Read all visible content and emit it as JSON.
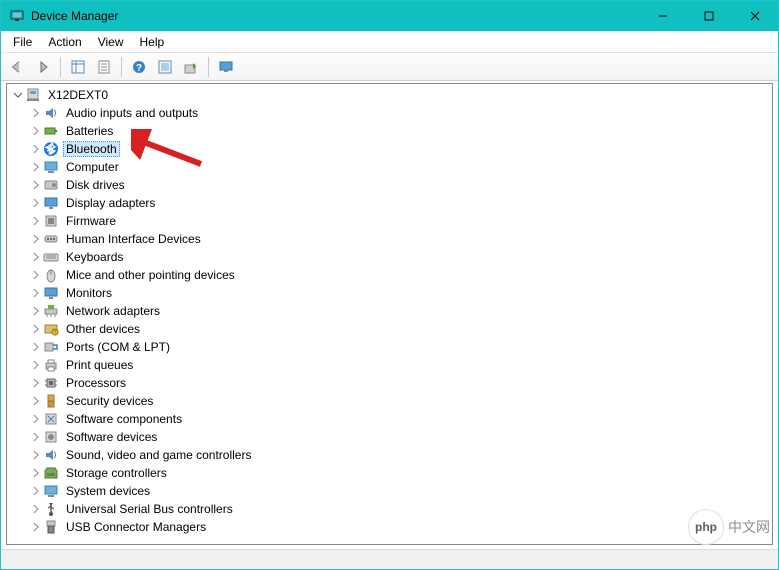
{
  "window": {
    "title": "Device Manager"
  },
  "menubar": {
    "file": "File",
    "action": "Action",
    "view": "View",
    "help": "Help"
  },
  "tree": {
    "root": "X12DEXT0",
    "items": [
      {
        "label": "Audio inputs and outputs",
        "icon": "audio"
      },
      {
        "label": "Batteries",
        "icon": "battery"
      },
      {
        "label": "Bluetooth",
        "icon": "bluetooth",
        "selected": true
      },
      {
        "label": "Computer",
        "icon": "computer"
      },
      {
        "label": "Disk drives",
        "icon": "disk"
      },
      {
        "label": "Display adapters",
        "icon": "display"
      },
      {
        "label": "Firmware",
        "icon": "firmware"
      },
      {
        "label": "Human Interface Devices",
        "icon": "hid"
      },
      {
        "label": "Keyboards",
        "icon": "keyboard"
      },
      {
        "label": "Mice and other pointing devices",
        "icon": "mouse"
      },
      {
        "label": "Monitors",
        "icon": "monitor"
      },
      {
        "label": "Network adapters",
        "icon": "network"
      },
      {
        "label": "Other devices",
        "icon": "other"
      },
      {
        "label": "Ports (COM & LPT)",
        "icon": "ports"
      },
      {
        "label": "Print queues",
        "icon": "printer"
      },
      {
        "label": "Processors",
        "icon": "cpu"
      },
      {
        "label": "Security devices",
        "icon": "security"
      },
      {
        "label": "Software components",
        "icon": "swcomp"
      },
      {
        "label": "Software devices",
        "icon": "swdev"
      },
      {
        "label": "Sound, video and game controllers",
        "icon": "sound"
      },
      {
        "label": "Storage controllers",
        "icon": "storage"
      },
      {
        "label": "System devices",
        "icon": "system"
      },
      {
        "label": "Universal Serial Bus controllers",
        "icon": "usb"
      },
      {
        "label": "USB Connector Managers",
        "icon": "usbconn"
      }
    ]
  },
  "watermark": {
    "logo": "php",
    "text": "中文网"
  }
}
